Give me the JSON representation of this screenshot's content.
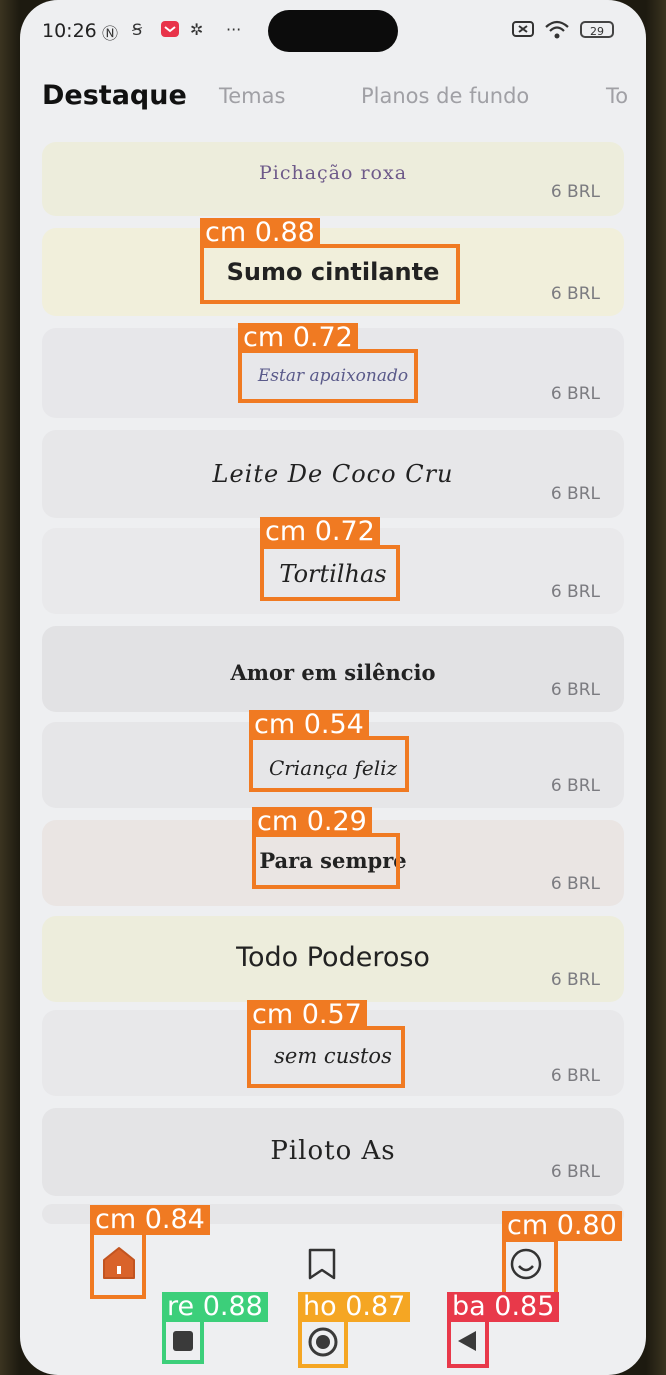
{
  "status_bar": {
    "time": "10:26",
    "icons": [
      "nfc-icon",
      "s-app-icon",
      "mail-app-icon",
      "settings-icon",
      "more-icon"
    ],
    "battery": "29"
  },
  "tabs": [
    {
      "label": "Destaque",
      "active": true
    },
    {
      "label": "Temas",
      "active": false
    },
    {
      "label": "Planos de fundo",
      "active": false
    },
    {
      "label": "To",
      "active": false
    }
  ],
  "items": [
    {
      "title": "Pichação roxa",
      "price": "6 BRL",
      "bg": "#ededdc"
    },
    {
      "title": "Sumo cintilante",
      "price": "6 BRL",
      "bg": "#f1efdb",
      "detection": {
        "label": "cm 0.88",
        "color": "#f07a22"
      }
    },
    {
      "title": "Estar apaixonado",
      "price": "6 BRL",
      "bg": "#e7e7ea",
      "detection": {
        "label": "cm 0.72",
        "color": "#f07a22"
      }
    },
    {
      "title": "Leite De Coco Cru",
      "price": "6 BRL",
      "bg": "#e7e7e9"
    },
    {
      "title": "Tortilhas",
      "price": "6 BRL",
      "bg": "#e9e9eb",
      "detection": {
        "label": "cm 0.72",
        "color": "#f07a22"
      }
    },
    {
      "title": "Amor em silêncio",
      "price": "6 BRL",
      "bg": "#e2e2e4"
    },
    {
      "title": "Criança feliz",
      "price": "6 BRL",
      "bg": "#e6e6e8",
      "detection": {
        "label": "cm 0.54",
        "color": "#f07a22"
      }
    },
    {
      "title": "Para sempre",
      "price": "6 BRL",
      "bg": "#eae5e3",
      "detection": {
        "label": "cm 0.29",
        "color": "#f07a22"
      }
    },
    {
      "title": "Todo Poderoso",
      "price": "6 BRL",
      "bg": "#ededdc"
    },
    {
      "title": "sem custos",
      "price": "6 BRL",
      "bg": "#e8e8ea",
      "detection": {
        "label": "cm 0.57",
        "color": "#f07a22"
      }
    },
    {
      "title": "Piloto As",
      "price": "6 BRL",
      "bg": "#e4e4e6"
    }
  ],
  "bottom_nav": [
    {
      "icon": "home-icon",
      "detection": {
        "label": "cm 0.84",
        "color": "#f07a22"
      }
    },
    {
      "icon": "bookmark-icon"
    },
    {
      "icon": "profile-icon",
      "detection": {
        "label": "cm 0.80",
        "color": "#f07a22"
      }
    }
  ],
  "system_nav": [
    {
      "icon": "recents-icon",
      "detection": {
        "label": "re 0.88",
        "color": "#3ccf7a"
      }
    },
    {
      "icon": "home-button-icon",
      "detection": {
        "label": "ho 0.87",
        "color": "#f5a623"
      }
    },
    {
      "icon": "back-icon",
      "detection": {
        "label": "ba 0.85",
        "color": "#e8394a"
      }
    }
  ]
}
